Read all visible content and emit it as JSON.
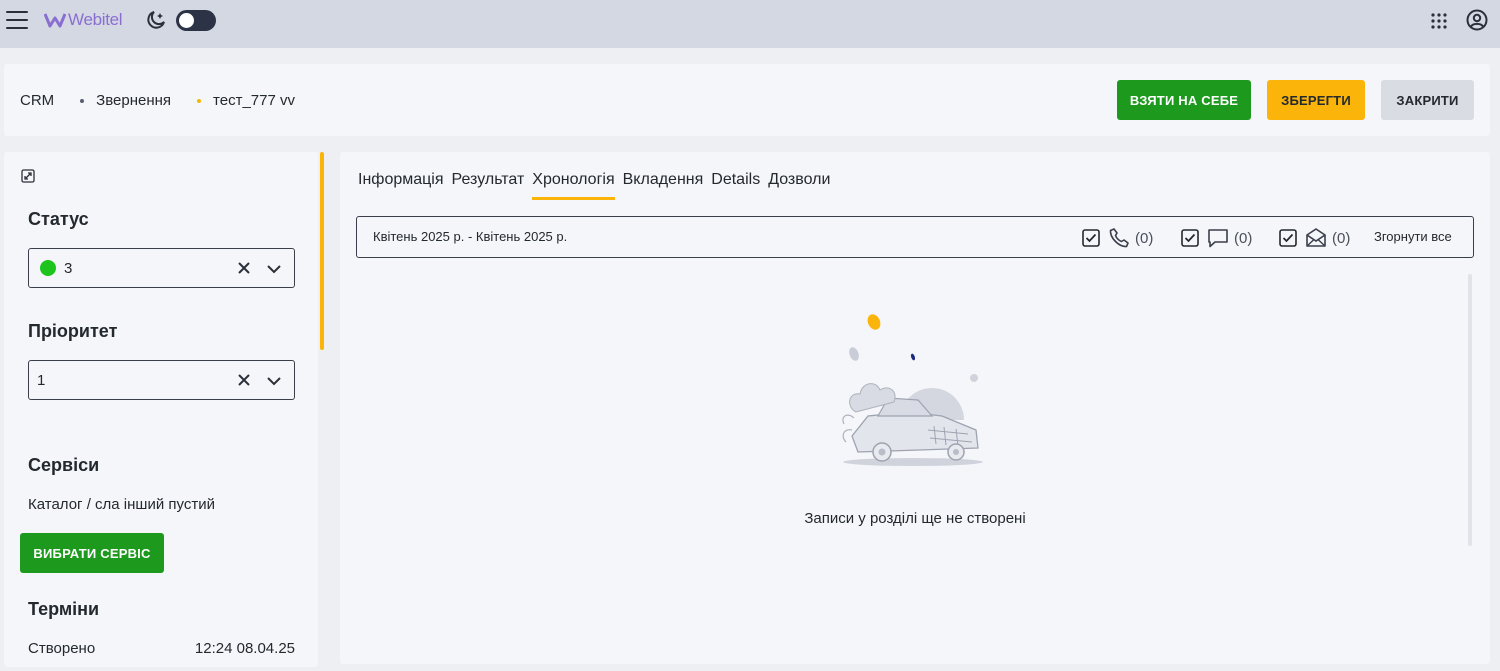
{
  "topbar": {
    "logo_text": "Webitel",
    "icons": [
      "menu-icon",
      "webitel-logo-icon",
      "night-mode-icon",
      "apps-grid-icon",
      "account-icon"
    ]
  },
  "header": {
    "breadcrumbs": [
      "CRM",
      "Звернення",
      "тест_777 vv"
    ],
    "buttons": {
      "take": "ВЗЯТИ НА СЕБЕ",
      "save": "ЗБЕРЕГТИ",
      "close": "ЗАКРИТИ"
    }
  },
  "left": {
    "status": {
      "title": "Статус",
      "value": "3",
      "color": "#1ec41e"
    },
    "priority": {
      "title": "Пріоритет",
      "value": "1"
    },
    "services": {
      "title": "Сервіси",
      "text": "Каталог / сла інший пустий",
      "button": "ВИБРАТИ СЕРВІС"
    },
    "terms": {
      "title": "Терміни",
      "created_label": "Створено",
      "created_value": "12:24 08.04.25"
    }
  },
  "main": {
    "tabs": [
      {
        "label": "Інформація",
        "active": false
      },
      {
        "label": "Результат",
        "active": false
      },
      {
        "label": "Хронологія",
        "active": true
      },
      {
        "label": "Вкладення",
        "active": false
      },
      {
        "label": "Details",
        "active": false
      },
      {
        "label": "Дозволи",
        "active": false
      }
    ],
    "filter": {
      "date_range": "Квітень 2025 р. - Квітень 2025 р.",
      "calls_count": "(0)",
      "chats_count": "(0)",
      "emails_count": "(0)",
      "collapse_all": "Згорнути все"
    },
    "empty_text": "Записи у розділі ще не створені"
  },
  "colors": {
    "accent_green": "#1d9a1d",
    "accent_yellow": "#fbb50a",
    "topbar_bg": "#d4d8e2"
  }
}
